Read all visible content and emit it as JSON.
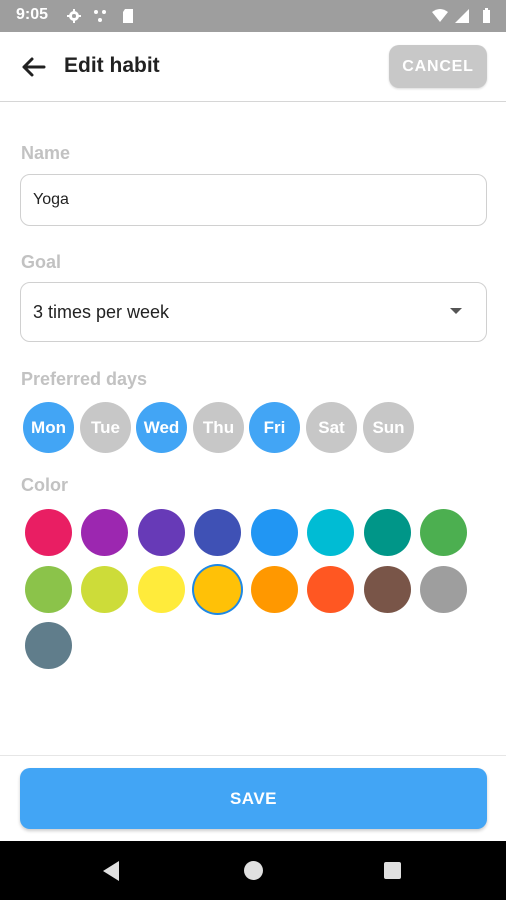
{
  "status_bar": {
    "time": "9:05",
    "icons": [
      "gear-icon",
      "dots-icon",
      "sd-card-icon",
      "wifi-icon",
      "signal-icon",
      "battery-icon"
    ]
  },
  "toolbar": {
    "back_icon": "arrow-left-icon",
    "title": "Edit habit",
    "cancel_label": "CANCEL"
  },
  "form": {
    "name_label": "Name",
    "name_value": "Yoga",
    "goal_label": "Goal",
    "goal_value": "3 times per week",
    "days_label": "Preferred days",
    "days": [
      {
        "label": "Mon",
        "selected": true
      },
      {
        "label": "Tue",
        "selected": false
      },
      {
        "label": "Wed",
        "selected": true
      },
      {
        "label": "Thu",
        "selected": false
      },
      {
        "label": "Fri",
        "selected": true
      },
      {
        "label": "Sat",
        "selected": false
      },
      {
        "label": "Sun",
        "selected": false
      }
    ],
    "color_label": "Color",
    "colors": [
      "#e91e63",
      "#9c27b0",
      "#673ab7",
      "#3f51b5",
      "#2196f3",
      "#00bcd4",
      "#009688",
      "#4caf50",
      "#8bc34a",
      "#cddc39",
      "#ffeb3b",
      "#ffc107",
      "#ff9800",
      "#ff5722",
      "#795548",
      "#9e9e9e",
      "#607d8b"
    ],
    "selected_color": "#ffc107"
  },
  "save_label": "SAVE",
  "theme": {
    "accent": "#42a5f5",
    "chip_off": "#c7c7c7"
  },
  "nav_bar": {
    "icons": [
      "nav-back-icon",
      "nav-home-icon",
      "nav-recents-icon"
    ]
  }
}
